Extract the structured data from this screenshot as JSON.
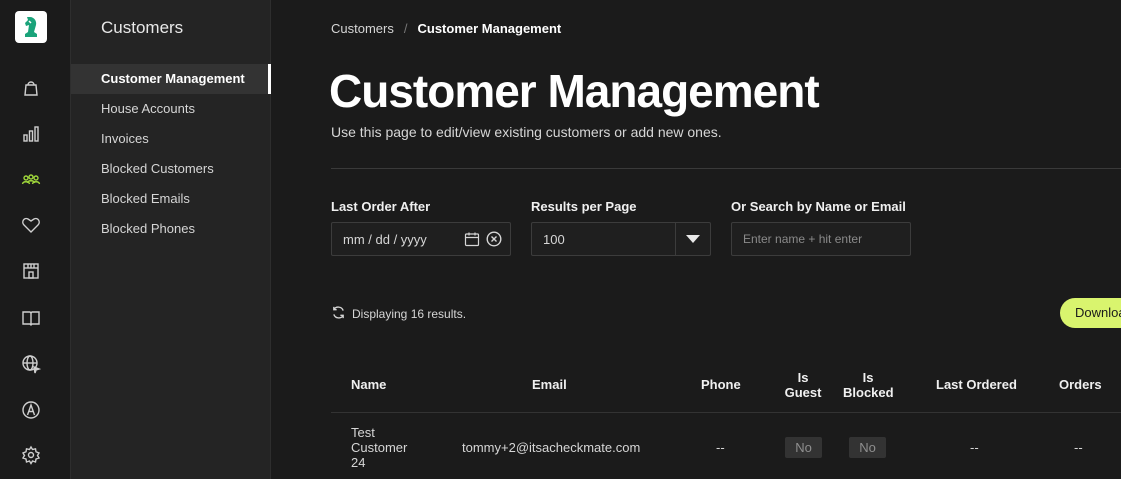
{
  "sidebar": {
    "title": "Customers",
    "items": [
      {
        "label": "Customer Management",
        "active": true
      },
      {
        "label": "House Accounts"
      },
      {
        "label": "Invoices"
      },
      {
        "label": "Blocked Customers"
      },
      {
        "label": "Blocked Emails"
      },
      {
        "label": "Blocked Phones"
      }
    ]
  },
  "rail_icons": [
    "orders-bag-icon",
    "reports-bar-chart-icon",
    "customers-people-icon",
    "loyalty-heart-icon",
    "store-icon",
    "menu-book-icon",
    "web-globe-icon",
    "ordering-app-icon",
    "settings-gear-icon"
  ],
  "breadcrumb": {
    "parent": "Customers",
    "separator": "/",
    "current": "Customer Management"
  },
  "page": {
    "title": "Customer Management",
    "subtitle": "Use this page to edit/view existing customers or add new ones."
  },
  "filters": {
    "last_order_label": "Last Order After",
    "last_order_value": "mm / dd / yyyy",
    "results_label": "Results per Page",
    "results_value": "100",
    "search_label": "Or Search by Name or Email",
    "search_placeholder": "Enter name + hit enter"
  },
  "results_text": "Displaying 16 results.",
  "download_label": "Download",
  "table": {
    "headers": {
      "name": "Name",
      "email": "Email",
      "phone": "Phone",
      "is_guest_1": "Is",
      "is_guest_2": "Guest",
      "is_blocked_1": "Is",
      "is_blocked_2": "Blocked",
      "last_ordered": "Last Ordered",
      "orders": "Orders"
    },
    "rows": [
      {
        "name_1": "Test",
        "name_2": "Customer",
        "name_3": "24",
        "email": "tommy+2@itsacheckmate.com",
        "phone": "--",
        "is_guest": "No",
        "is_blocked": "No",
        "last_ordered": "--",
        "orders": "--"
      }
    ]
  },
  "colors": {
    "accent": "#d9f46e",
    "active_icon": "#9fd63b",
    "background": "#1b1b1b",
    "logo": "#1aa37a"
  }
}
